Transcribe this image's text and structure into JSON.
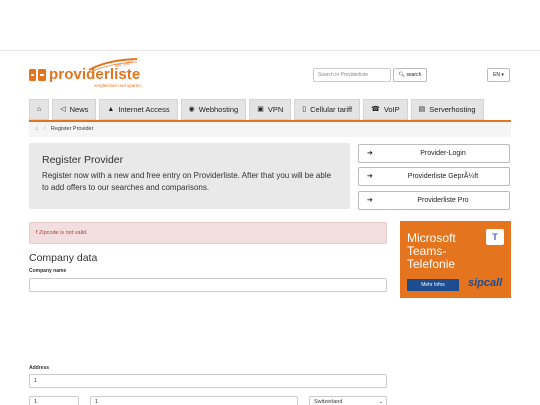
{
  "header": {
    "logo_text": "providerliste",
    "logo_sub": "vergleichen und sparen",
    "logo_badge": "seit 1997",
    "search_placeholder": "Search in Providerliste",
    "search_button": "search",
    "lang": "EN"
  },
  "nav": {
    "items": [
      {
        "label": "",
        "icon": "home-icon"
      },
      {
        "label": "News",
        "icon": "megaphone-icon"
      },
      {
        "label": "Internet Access",
        "icon": "road-icon"
      },
      {
        "label": "Webhosting",
        "icon": "globe-icon"
      },
      {
        "label": "VPN",
        "icon": "lock-icon"
      },
      {
        "label": "Cellular tariff",
        "icon": "phone-icon"
      },
      {
        "label": "VoIP",
        "icon": "handset-icon"
      },
      {
        "label": "Serverhosting",
        "icon": "server-icon"
      }
    ]
  },
  "breadcrumb": {
    "current": "Register Provider"
  },
  "jumbo": {
    "title": "Register Provider",
    "text": "Register now with a new and free entry on Providerliste. After that you will be able to add offers to our searches and comparisons."
  },
  "side_buttons": [
    {
      "label": "Provider-Login",
      "icon": "login-icon"
    },
    {
      "label": "Providerliste GeprÃ¼ft",
      "icon": "arrow-right-icon"
    },
    {
      "label": "Providerliste Pro",
      "icon": "arrow-right-icon"
    }
  ],
  "alert": {
    "text": "Zipcode is not valid."
  },
  "ad": {
    "line1": "Microsoft",
    "line2": "Teams-",
    "line3": "Telefonie",
    "button": "Mehr Infos",
    "brand": "sipcall",
    "badge": "T"
  },
  "form": {
    "section_title": "Company data",
    "company_label": "Company name",
    "company_value": "",
    "address_label": "Address",
    "address_value": "1",
    "zip_value": "1",
    "city_value": "1",
    "country_value": "Switzerland"
  },
  "colors": {
    "brand_orange": "#e4741e",
    "alert_bg": "#f2dede",
    "alert_text": "#a94442",
    "ad_blue": "#1d4c8f"
  }
}
